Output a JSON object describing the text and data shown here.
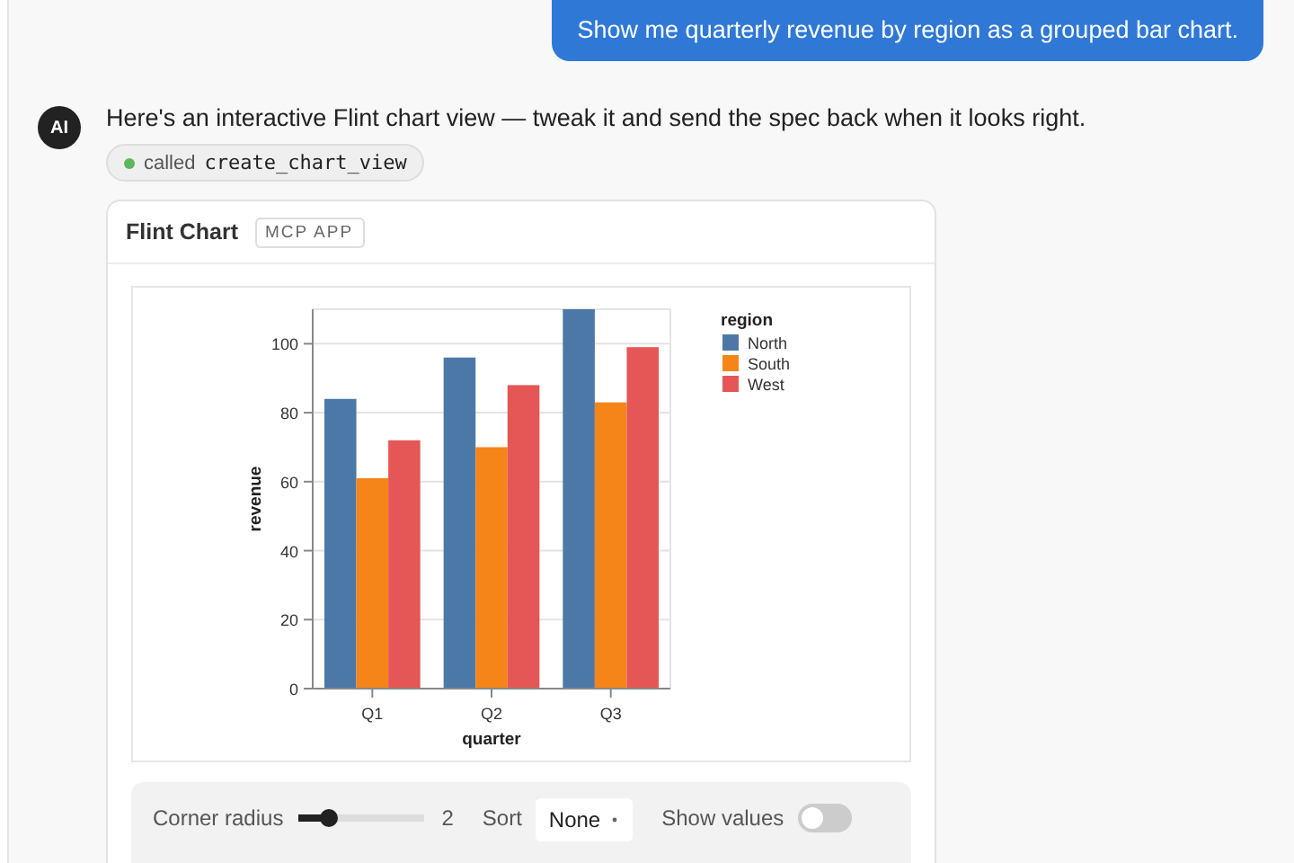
{
  "user_message": {
    "text": "Show me quarterly revenue by region as a grouped bar chart."
  },
  "assistant": {
    "avatar": "AI",
    "text": "Here's an interactive Flint chart view — tweak it and send the spec back when it looks right.",
    "tool_call": {
      "label": "called",
      "name": "create_chart_view",
      "color": "#5cb85c"
    }
  },
  "app_card": {
    "title": "Flint Chart",
    "badge": "MCP APP",
    "chart_data": {
      "type": "bar",
      "xlabel": "quarter",
      "ylabel": "revenue",
      "categories": [
        "Q1",
        "Q2",
        "Q3"
      ],
      "legend": {
        "title": "region"
      },
      "grid": true,
      "ylim": [
        0,
        110
      ],
      "yticks": [
        0,
        20,
        40,
        60,
        80,
        100
      ],
      "series": [
        {
          "name": "North",
          "color": "#4c78a8",
          "values": [
            84,
            96,
            110
          ]
        },
        {
          "name": "South",
          "color": "#f58518",
          "values": [
            61,
            70,
            83
          ]
        },
        {
          "name": "West",
          "color": "#e45756",
          "values": [
            72,
            88,
            99
          ]
        }
      ]
    },
    "controls": {
      "corner_radius": {
        "label": "Corner radius",
        "level": 0.25,
        "reading": "2"
      },
      "sort": {
        "label": "Sort",
        "value": "None"
      },
      "show_values": {
        "label": "Show values",
        "on": false
      }
    }
  }
}
